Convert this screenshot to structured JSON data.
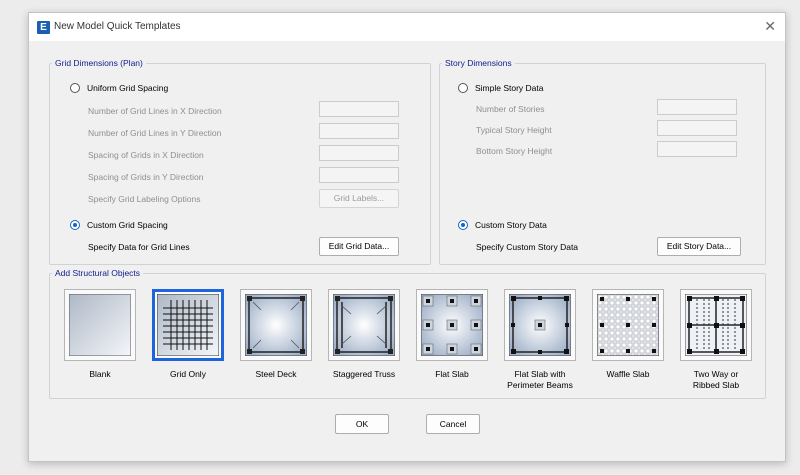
{
  "window": {
    "title": "New Model Quick Templates",
    "app_icon_letter": "E",
    "close_glyph": "✕"
  },
  "grid_dimensions": {
    "title": "Grid Dimensions (Plan)",
    "uniform_label": "Uniform Grid Spacing",
    "fields": [
      "Number of Grid Lines in X Direction",
      "Number of Grid Lines in Y Direction",
      "Spacing of Grids in X Direction",
      "Spacing of Grids in Y Direction"
    ],
    "labeling_label": "Specify Grid Labeling Options",
    "grid_labels_button": "Grid Labels...",
    "custom_label": "Custom Grid Spacing",
    "custom_data_label": "Specify Data for Grid Lines",
    "edit_grid_button": "Edit Grid Data..."
  },
  "story_dimensions": {
    "title": "Story Dimensions",
    "simple_label": "Simple Story Data",
    "fields": [
      "Number of Stories",
      "Typical Story Height",
      "Bottom Story Height"
    ],
    "custom_label": "Custom Story Data",
    "custom_data_label": "Specify Custom Story Data",
    "edit_story_button": "Edit Story Data..."
  },
  "structural_objects": {
    "title": "Add Structural Objects",
    "templates": [
      {
        "label": "Blank",
        "icon": "blank-icon"
      },
      {
        "label": "Grid Only",
        "icon": "grid-icon",
        "selected": true
      },
      {
        "label": "Steel Deck",
        "icon": "steel-deck-icon"
      },
      {
        "label": "Staggered Truss",
        "icon": "staggered-truss-icon"
      },
      {
        "label": "Flat Slab",
        "icon": "flat-slab-icon"
      },
      {
        "label": "Flat Slab with\nPerimeter Beams",
        "icon": "flat-slab-beams-icon"
      },
      {
        "label": "Waffle Slab",
        "icon": "waffle-slab-icon"
      },
      {
        "label": "Two Way or\nRibbed Slab",
        "icon": "ribbed-slab-icon"
      }
    ]
  },
  "footer": {
    "ok": "OK",
    "cancel": "Cancel"
  },
  "colors": {
    "accent": "#1565c0",
    "group_title": "#13208f",
    "selection": "#1e64dc"
  }
}
